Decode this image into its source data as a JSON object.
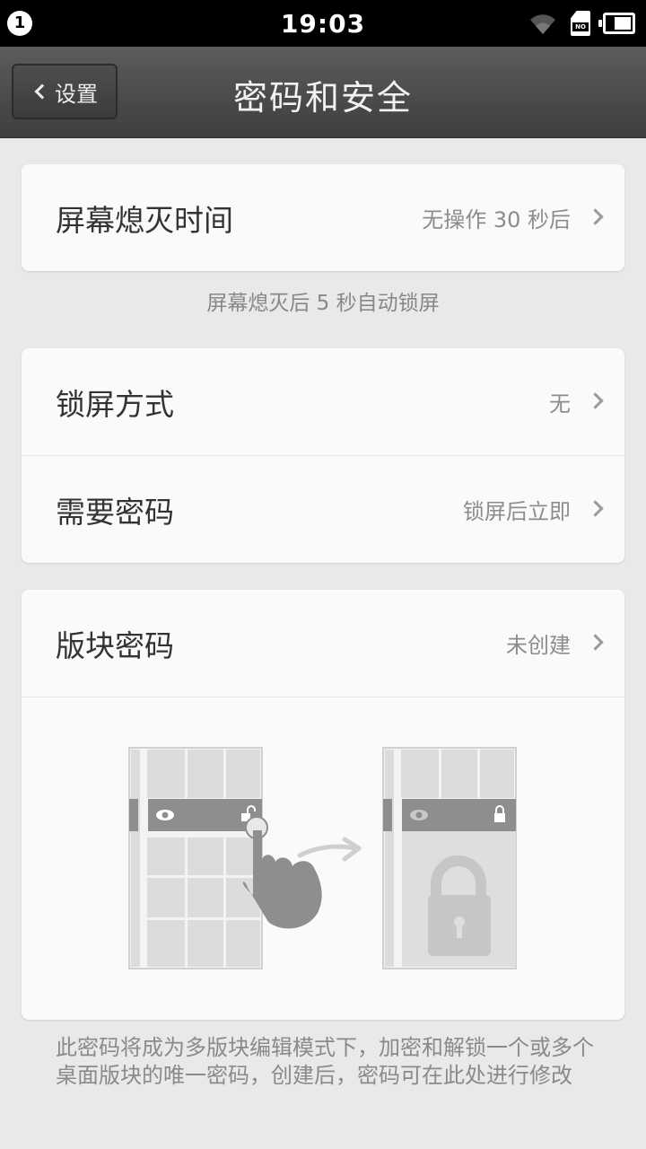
{
  "status_bar": {
    "notification_count": "1",
    "time": "19:03",
    "sim_label": "NO"
  },
  "nav": {
    "back_label": "设置",
    "title": "密码和安全"
  },
  "screen_timeout": {
    "label": "屏幕熄灭时间",
    "value": "无操作 30 秒后",
    "hint": "屏幕熄灭后 5 秒自动锁屏"
  },
  "lock": {
    "lock_method_label": "锁屏方式",
    "lock_method_value": "无",
    "require_password_label": "需要密码",
    "require_password_value": "锁屏后立即"
  },
  "panel_password": {
    "label": "版块密码",
    "value": "未创建",
    "description": "此密码将成为多版块编辑模式下，加密和解锁一个或多个桌面版块的唯一密码，创建后，密码可在此处进行修改"
  },
  "icons": {
    "back": "chevron-left-icon",
    "row_arrow": "chevron-right-icon",
    "wifi": "wifi-icon",
    "battery": "battery-icon",
    "sim": "no-sim-icon"
  },
  "colors": {
    "background": "#e9e9ec",
    "card": "#fafafa",
    "navbar": "#4a4a4c",
    "value_text": "#8c8c8c"
  }
}
